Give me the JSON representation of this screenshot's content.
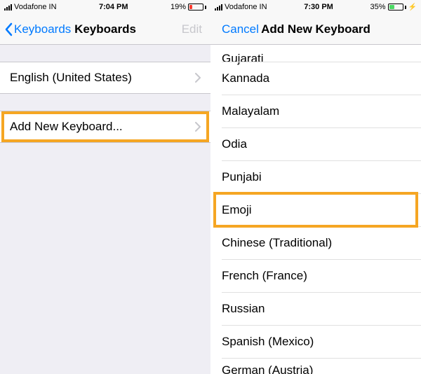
{
  "left": {
    "status": {
      "carrier": "Vodafone IN",
      "time": "7:04 PM",
      "battery_pct": "19%"
    },
    "nav": {
      "back": "Keyboards",
      "title": "Keyboards",
      "edit": "Edit"
    },
    "rows": {
      "english": "English (United States)",
      "add": "Add New Keyboard..."
    }
  },
  "right": {
    "status": {
      "carrier": "Vodafone IN",
      "time": "7:30 PM",
      "battery_pct": "35%"
    },
    "nav": {
      "cancel": "Cancel",
      "title": "Add New Keyboard"
    },
    "items": [
      "Gujarati",
      "Kannada",
      "Malayalam",
      "Odia",
      "Punjabi",
      "Emoji",
      "Chinese (Traditional)",
      "French (France)",
      "Russian",
      "Spanish (Mexico)",
      "German (Austria)"
    ]
  }
}
